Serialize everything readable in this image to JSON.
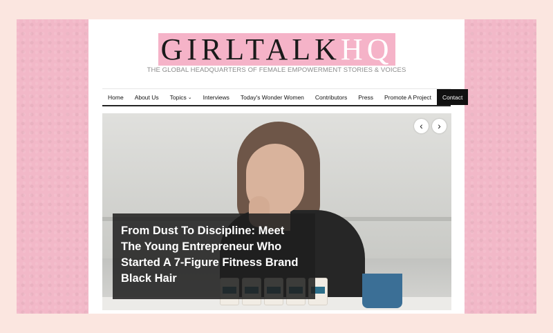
{
  "logo": {
    "main": "GIRLTALK",
    "hq": "HQ"
  },
  "tagline": "THE GLOBAL HEADQUARTERS OF FEMALE EMPOWERMENT STORIES & VOICES",
  "nav": {
    "home": "Home",
    "about": "About Us",
    "topics": "Topics",
    "interviews": "Interviews",
    "wonder_women": "Today's Wonder Women",
    "contributors": "Contributors",
    "press": "Press",
    "promote": "Promote A Project",
    "contact": "Contact"
  },
  "slider": {
    "headline": "From Dust To Discipline: Meet The Young Entrepreneur Who Started A 7-Figure Fitness Brand Black Hair",
    "prev_icon": "‹",
    "next_icon": "›"
  }
}
